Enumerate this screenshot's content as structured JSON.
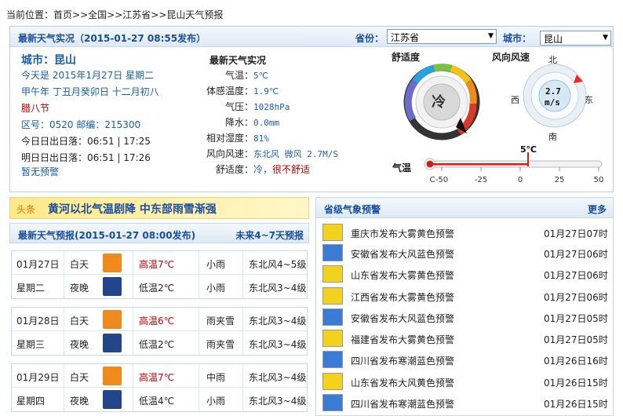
{
  "breadcrumb": {
    "label": "当前位置：",
    "items": [
      "首页",
      ">>全国",
      ">>江苏省",
      ">>昆山天气预报"
    ]
  },
  "current": {
    "title": "最新天气实况（2015-01-27 08:55发布）",
    "province_label": "省份：",
    "province_value": "江苏省",
    "city_label": "城市：",
    "city_value": "昆山"
  },
  "city_info": {
    "city": "城市：昆山",
    "today": "今天是 2015年1月27日 星期二",
    "lunar": "甲午年 丁丑月癸卯日 十二月初八",
    "festival": "腊八节",
    "codes": "区号：0520   邮编：215300",
    "sun_today": "今日日出日落：06:51 | 17:25",
    "sun_tomorrow": "明日日出日落：06:51 | 17:26",
    "warning": "暂无预警"
  },
  "live": {
    "title": "最新天气实况",
    "rows": [
      {
        "label": "气温：",
        "value": "5℃"
      },
      {
        "label": "体感温度：",
        "value": "1.9℃"
      },
      {
        "label": "气压：",
        "value": "1028hPa"
      },
      {
        "label": "降水：",
        "value": "0.0mm"
      },
      {
        "label": "相对湿度：",
        "value": "81%"
      },
      {
        "label": "风向风速：",
        "value": "东北风 微风 2.7M/S"
      }
    ],
    "comfort_label": "舒适度：",
    "comfort_value": "冷，",
    "comfort_note": "很不舒适"
  },
  "gauges": {
    "comfort_title": "舒适度",
    "comfort_value": "冷",
    "wind_title": "风向风速",
    "wind_value": "2.7",
    "wind_unit": "m/s",
    "north": "北",
    "south": "南",
    "east": "东",
    "west": "西",
    "temp_label": "气温",
    "temp_value": "5℃",
    "temp_now": 5,
    "temp_min": -50,
    "temp_max": 50,
    "temp_ticks": [
      "C",
      "-50",
      "-25",
      "0",
      "25",
      "50"
    ]
  },
  "headline": {
    "tag": "头条",
    "text": "黄河以北气温剧降 中东部雨雪渐强"
  },
  "forecast": {
    "title": "最新天气预报(2015-01-27 08:00发布)",
    "more": "未来4~7天预报",
    "days": [
      {
        "date": "01月27日",
        "weekday": "星期二",
        "day": {
          "period": "白天",
          "temp": "高温7℃",
          "weather": "小雨",
          "wind": "东北风4~5级"
        },
        "night": {
          "period": "夜晚",
          "temp": "低温2℃",
          "weather": "小雨",
          "wind": "东北风3~4级"
        }
      },
      {
        "date": "01月28日",
        "weekday": "星期三",
        "day": {
          "period": "白天",
          "temp": "高温6℃",
          "weather": "雨夹雪",
          "wind": "东北风3~4级"
        },
        "night": {
          "period": "夜晚",
          "temp": "低温2℃",
          "weather": "雨夹雪",
          "wind": "东北风3~4级"
        }
      },
      {
        "date": "01月29日",
        "weekday": "星期四",
        "day": {
          "period": "白天",
          "temp": "高温7℃",
          "weather": "中雨",
          "wind": "东北风3~4级"
        },
        "night": {
          "period": "夜晚",
          "temp": "低温4℃",
          "weather": "小雨",
          "wind": "东北风3~4级"
        }
      }
    ]
  },
  "alerts": {
    "title": "省级气象预警",
    "more": "更多",
    "items": [
      {
        "text": "重庆市发布大雾黄色预警",
        "time": "01月27日07时",
        "color": "#f2d21c"
      },
      {
        "text": "安徽省发布大风蓝色预警",
        "time": "01月27日06时",
        "color": "#3a7bd5"
      },
      {
        "text": "山东省发布大雾黄色预警",
        "time": "01月27日06时",
        "color": "#f2d21c"
      },
      {
        "text": "江西省发布大雾黄色预警",
        "time": "01月27日06时",
        "color": "#f2d21c"
      },
      {
        "text": "安徽省发布大风蓝色预警",
        "time": "01月27日05时",
        "color": "#3a7bd5"
      },
      {
        "text": "福建省发布大雾黄色预警",
        "time": "01月27日05时",
        "color": "#f2d21c"
      },
      {
        "text": "四川省发布寒潮蓝色预警",
        "time": "01月26日16时",
        "color": "#3a7bd5"
      },
      {
        "text": "山东省发布大风黄色预警",
        "time": "01月26日15时",
        "color": "#f2d21c"
      },
      {
        "text": "四川省发布寒潮蓝色预警",
        "time": "01月26日15时",
        "color": "#3a7bd5"
      }
    ]
  }
}
